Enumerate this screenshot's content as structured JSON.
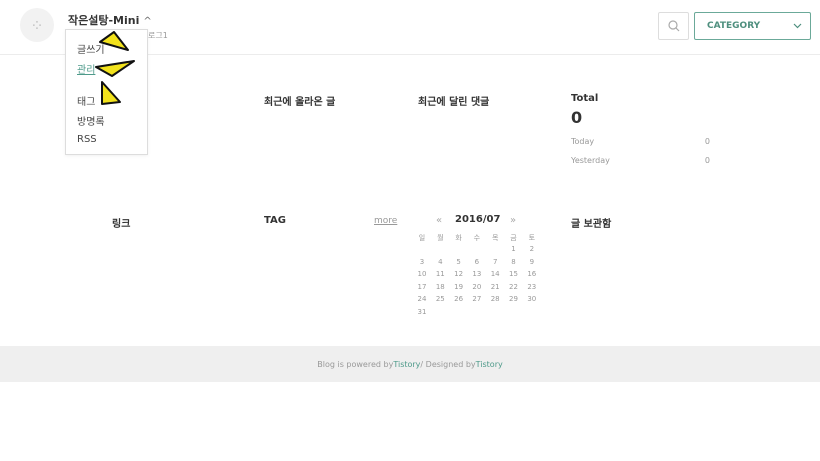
{
  "header": {
    "blog_title": "작은설탕-Mini",
    "title_chevron": "^",
    "blog_subtitle": "로그1",
    "search_icon": "search-icon",
    "category_label": "CATEGORY",
    "category_chevron": "⌄"
  },
  "dropdown": {
    "items": [
      {
        "label": "글쓰기"
      },
      {
        "label": "관리"
      },
      {
        "label": "태그"
      },
      {
        "label": "방명록"
      },
      {
        "label": "RSS"
      }
    ],
    "active_index": 1,
    "pointer_color": "#f2e21c"
  },
  "sections": {
    "recent_posts": "최근에 올라온 글",
    "recent_comments": "최근에 달린 댓글",
    "total_label": "Total",
    "total_value": "0",
    "today_label": "Today",
    "today_value": "0",
    "yesterday_label": "Yesterday",
    "yesterday_value": "0",
    "links": "링크",
    "tag": "TAG",
    "more": "more",
    "archive": "글 보관함"
  },
  "calendar": {
    "prev": "«",
    "next": "»",
    "title": "2016/07",
    "weekdays": [
      "일",
      "월",
      "화",
      "수",
      "목",
      "금",
      "토"
    ],
    "weeks": [
      [
        "",
        "",
        "",
        "",
        "",
        "1",
        "2"
      ],
      [
        "3",
        "4",
        "5",
        "6",
        "7",
        "8",
        "9"
      ],
      [
        "10",
        "11",
        "12",
        "13",
        "14",
        "15",
        "16"
      ],
      [
        "17",
        "18",
        "19",
        "20",
        "21",
        "22",
        "23"
      ],
      [
        "24",
        "25",
        "26",
        "27",
        "28",
        "29",
        "30"
      ],
      [
        "31",
        "",
        "",
        "",
        "",
        "",
        ""
      ]
    ]
  },
  "footer": {
    "prefix": "Blog is powered by ",
    "powered_link": "Tistory",
    "middle": " / Designed by ",
    "designed_link": "Tistory"
  },
  "colors": {
    "accent": "#4e9a8a",
    "category_border": "#6ba999",
    "footer_bg": "#efefef"
  }
}
